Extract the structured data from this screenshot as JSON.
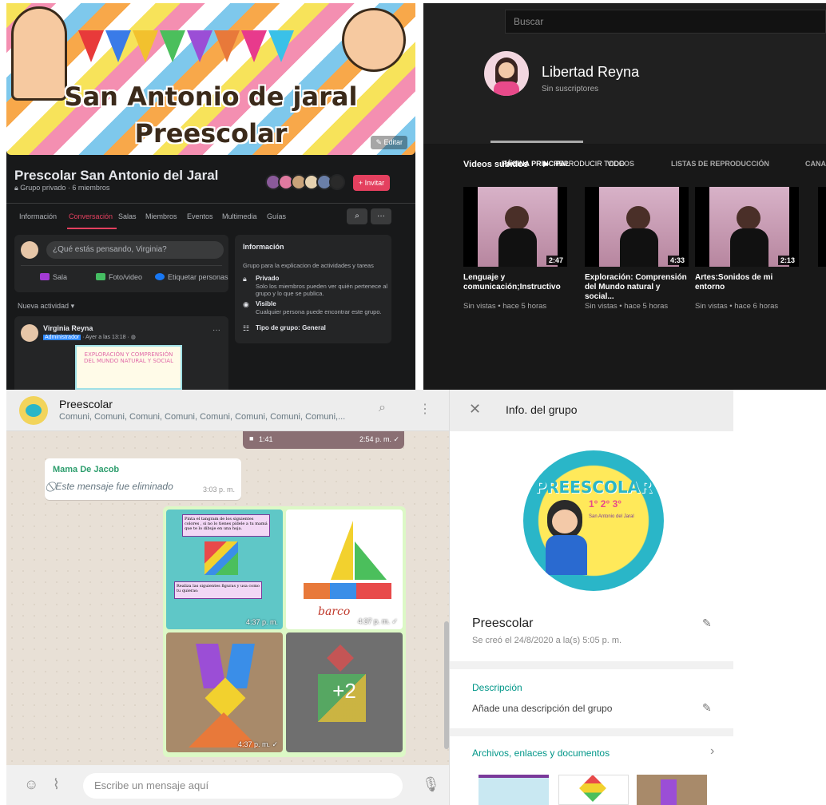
{
  "facebook": {
    "cover_title_line1": "San Antonio de jaral",
    "cover_title_line2": "Preescolar",
    "edit_label": "Editar",
    "group_name": "Prescolar San Antonio del Jaral",
    "group_meta": "Grupo privado · 6 miembros",
    "invite_label": "+ Invitar",
    "tabs": [
      "Información",
      "Conversación",
      "Salas",
      "Miembros",
      "Eventos",
      "Multimedia",
      "Guías"
    ],
    "active_tab": "Conversación",
    "composer_placeholder": "¿Qué estás pensando, Virginia?",
    "composer_actions": [
      "Sala",
      "Foto/video",
      "Etiquetar personas"
    ],
    "activity_label": "Nueva actividad",
    "post": {
      "author": "Virginia Reyna",
      "role": "Administrador",
      "time": "· Ayer a las 13:18 ·",
      "image_text": "EXPLORACIÓN Y COMPRENSIÓN DEL MUNDO NATURAL Y SOCIAL"
    },
    "info": {
      "title": "Información",
      "description": "Grupo para la explicacion de actividades y tareas",
      "private_title": "Privado",
      "private_text": "Solo los miembros pueden ver quién pertenece al grupo y lo que se publica.",
      "visible_title": "Visible",
      "visible_text": "Cualquier persona puede encontrar este grupo.",
      "type": "Tipo de grupo: General"
    }
  },
  "youtube": {
    "search_placeholder": "Buscar",
    "channel_name": "Libertad Reyna",
    "subscribers": "Sin suscriptores",
    "tabs": [
      "PÁGINA PRINCIPAL",
      "VIDEOS",
      "LISTAS DE REPRODUCCIÓN",
      "CANA"
    ],
    "section_title": "Videos subidos",
    "play_all": "REPRODUCIR TODO",
    "videos": [
      {
        "title": "Lenguaje y comunicación;Instructivo",
        "duration": "2:47",
        "meta": "Sin vistas • hace 5 horas"
      },
      {
        "title": "Exploración: Comprensión del Mundo natural y social...",
        "duration": "4:33",
        "meta": "Sin vistas • hace 5 horas"
      },
      {
        "title": "Artes:Sonidos de mi entorno",
        "duration": "2:13",
        "meta": "Sin vistas • hace 6 horas"
      }
    ]
  },
  "whatsapp": {
    "chat_name": "Preescolar",
    "participants": "Comuni, Comuni, Comuni, Comuni, Comuni, Comuni, Comuni, Comuni,...",
    "top_media_duration": "1:41",
    "top_media_time": "2:54 p. m. ✓",
    "deleted_sender": "Mama De Jacob",
    "deleted_text": "Este mensaje fue eliminado",
    "deleted_time": "3:03 p. m.",
    "grid_texts": {
      "instruction1": "Pinta el tangram de los siguientes colores , si no lo tienes pídele a tu mamá que te lo dibuje en una hoja.",
      "instruction2": "Realiza las siguientes figuras y usa como tu quieras:",
      "barco_label": "barco"
    },
    "grid_times": [
      "4:37 p. m.",
      "4:37 p. m. ✓",
      "4:37 p. m. ✓"
    ],
    "more_count": "+2",
    "input_placeholder": "Escribe un mensaje aquí"
  },
  "group_info": {
    "title": "Info. del grupo",
    "photo_text": {
      "title": "PREESCOLAR",
      "grades": "1° 2° 3°",
      "school": "San Antonio del Jaral"
    },
    "group_name": "Preescolar",
    "created": "Se creó el 24/8/2020 a la(s) 5:05 p. m.",
    "description_header": "Descripción",
    "description_placeholder": "Añade una descripción del grupo",
    "files_header": "Archivos, enlaces y documentos"
  },
  "colors": {
    "fb_bg": "#18191a",
    "fb_accent": "#e4405f",
    "yt_bg": "#181818",
    "wa_green": "#009688",
    "wa_bubble_out": "#dcf8c6"
  }
}
